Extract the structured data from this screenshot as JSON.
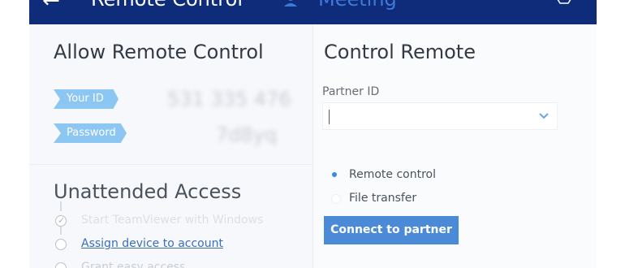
{
  "header": {
    "back_icon": "back-arrow-icon",
    "tab_remote_label": "Remote Control",
    "tab_meeting_label": "Meeting",
    "meeting_icon": "person-icon",
    "corner_icon": "account-icon"
  },
  "allow": {
    "title": "Allow Remote Control",
    "your_id_label": "Your ID",
    "password_label": "Password",
    "your_id_value": "531 335 476",
    "password_value": "7d8yq"
  },
  "unattended": {
    "title": "Unattended Access",
    "steps": [
      {
        "label": "Start TeamViewer with Windows",
        "done": true
      },
      {
        "label": "Assign device to account",
        "done": false
      },
      {
        "label": "Grant easy access",
        "done": false
      }
    ]
  },
  "control": {
    "title": "Control Remote",
    "partner_label": "Partner ID",
    "partner_value": "",
    "options": [
      {
        "label": "Remote control",
        "selected": true
      },
      {
        "label": "File transfer",
        "selected": false
      }
    ],
    "connect_label": "Connect to partner"
  },
  "colors": {
    "header_bg": "#0e2c7a",
    "accent": "#4a8ad6",
    "tag_bg": "#8cc6f2",
    "link": "#3a6fb5"
  }
}
